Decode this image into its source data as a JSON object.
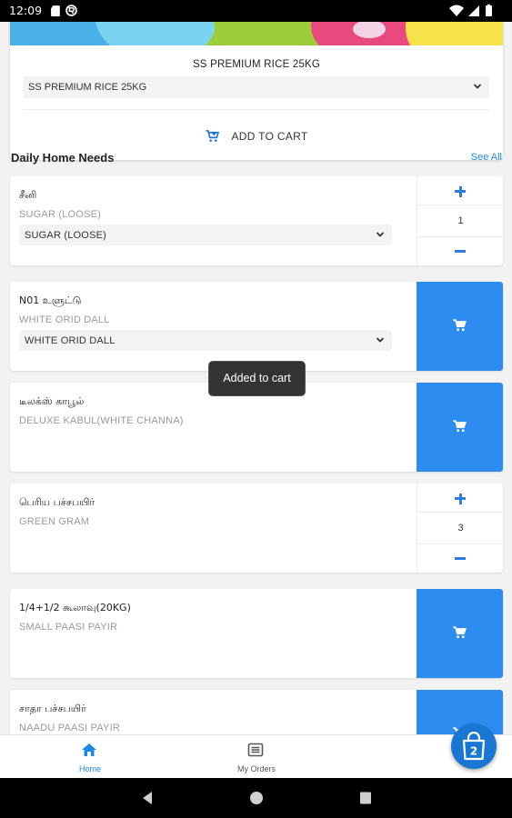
{
  "status_bar": {
    "time": "12:09"
  },
  "featured": {
    "title": "SS PREMIUM RICE 25KG",
    "selected_variant": "SS PREMIUM RICE 25KG",
    "add_to_cart_label": "ADD TO CART"
  },
  "section": {
    "title": "Daily Home Needs",
    "see_all": "See All"
  },
  "products": [
    {
      "tamil_name": "சீனி",
      "english_name": "SUGAR (LOOSE)",
      "variant": "SUGAR (LOOSE)",
      "qty": "1"
    },
    {
      "tamil_name": "N01 உளுட்டு",
      "english_name": "WHITE ORID DALL",
      "variant": "WHITE ORID DALL"
    },
    {
      "tamil_name": "டீலக்ஸ் காபூல்",
      "english_name": "DELUXE KABUL(WHITE CHANNA)"
    },
    {
      "tamil_name": "பெரிய பச்சபயிர்",
      "english_name": "GREEN GRAM",
      "qty": "3"
    },
    {
      "tamil_name": "1/4+1/2 கூலாவு(20KG)",
      "english_name": "SMALL PAASI PAYIR"
    },
    {
      "tamil_name": "சாதா பச்சபயிர்",
      "english_name": "NAADU PAASI PAYIR"
    }
  ],
  "toast": "Added to cart",
  "bottom_nav": {
    "items": [
      {
        "label": "Home",
        "icon": "home-icon"
      },
      {
        "label": "My Orders",
        "icon": "orders-icon"
      }
    ],
    "cart_count": "2"
  },
  "colors": {
    "accent": "#2d8cf0",
    "link": "#1e88e5",
    "fab": "#1976d2"
  }
}
